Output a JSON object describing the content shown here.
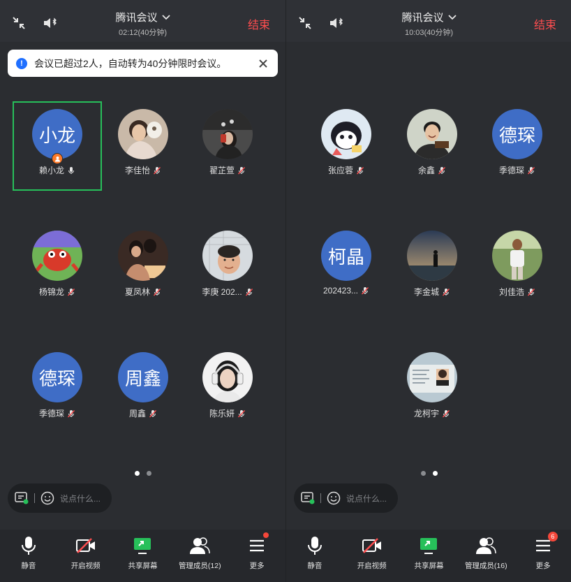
{
  "colors": {
    "accent_end": "#ff4d4f",
    "avatar_blue": "#3f6dc6",
    "speaking_border": "#27c05a",
    "toast_icon": "#1f6fff"
  },
  "left": {
    "title": "腾讯会议",
    "subtitle": "02:12(40分钟)",
    "end_label": "结束",
    "toast": "会议已超过2人，自动转为40分钟限时会议。",
    "participants": [
      {
        "name": "赖小龙",
        "avatar_text": "小龙",
        "mic": "on",
        "host": true,
        "selected": true
      },
      {
        "name": "李佳怡",
        "avatar_text": "",
        "mic": "off"
      },
      {
        "name": "翟芷萱",
        "avatar_text": "",
        "mic": "off"
      },
      {
        "name": "杨锦龙",
        "avatar_text": "",
        "mic": "off"
      },
      {
        "name": "夏凤林",
        "avatar_text": "",
        "mic": "off"
      },
      {
        "name": "李庚 202...",
        "avatar_text": "",
        "mic": "off"
      },
      {
        "name": "季德琛",
        "avatar_text": "德琛",
        "mic": "off"
      },
      {
        "name": "周鑫",
        "avatar_text": "周鑫",
        "mic": "off"
      },
      {
        "name": "陈乐妍",
        "avatar_text": "",
        "mic": "off"
      }
    ],
    "chat_placeholder": "说点什么...",
    "toolbar": [
      {
        "label": "静音",
        "icon": "mic-icon"
      },
      {
        "label": "开启视频",
        "icon": "video-off-icon"
      },
      {
        "label": "共享屏幕",
        "icon": "share-screen-icon"
      },
      {
        "label": "管理成员(12)",
        "icon": "members-icon"
      },
      {
        "label": "更多",
        "icon": "more-icon"
      }
    ],
    "page_active": 0
  },
  "right": {
    "title": "腾讯会议",
    "subtitle": "10:03(40分钟)",
    "end_label": "结束",
    "participants": [
      {
        "name": "张应蓉",
        "avatar_text": "",
        "mic": "off"
      },
      {
        "name": "余鑫",
        "avatar_text": "",
        "mic": "off"
      },
      {
        "name": "季德琛",
        "avatar_text": "德琛",
        "mic": "off"
      },
      {
        "name": "202423...",
        "avatar_text": "柯晶",
        "mic": "off"
      },
      {
        "name": "李金城",
        "avatar_text": "",
        "mic": "off"
      },
      {
        "name": "刘佳浩",
        "avatar_text": "",
        "mic": "off"
      },
      {
        "name": "龙柯宇",
        "avatar_text": "",
        "mic": "off"
      }
    ],
    "chat_placeholder": "说点什么...",
    "toolbar": [
      {
        "label": "静音",
        "icon": "mic-icon"
      },
      {
        "label": "开启视频",
        "icon": "video-off-icon"
      },
      {
        "label": "共享屏幕",
        "icon": "share-screen-icon"
      },
      {
        "label": "管理成员(16)",
        "icon": "members-icon"
      },
      {
        "label": "更多",
        "icon": "more-icon",
        "badge": "6"
      }
    ],
    "page_active": 1
  }
}
